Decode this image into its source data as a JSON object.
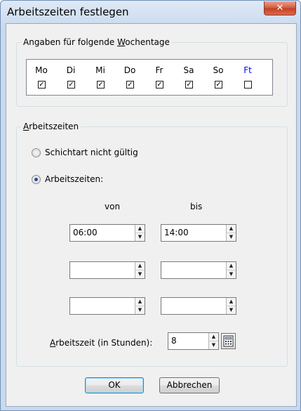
{
  "window": {
    "title": "Arbeitszeiten festlegen",
    "close_symbol": "✕"
  },
  "weekdays_group": {
    "label_before": "Angaben für folgende ",
    "label_underlined": "W",
    "label_after": "ochentage",
    "days": [
      {
        "label": "Mo",
        "checked": true,
        "color": "#000000"
      },
      {
        "label": "Di",
        "checked": true,
        "color": "#000000"
      },
      {
        "label": "Mi",
        "checked": true,
        "color": "#000000"
      },
      {
        "label": "Do",
        "checked": true,
        "color": "#000000"
      },
      {
        "label": "Fr",
        "checked": true,
        "color": "#000000"
      },
      {
        "label": "Sa",
        "checked": true,
        "color": "#000000"
      },
      {
        "label": "So",
        "checked": true,
        "color": "#000000"
      },
      {
        "label": "Ft",
        "checked": false,
        "color": "#0000ff"
      }
    ]
  },
  "worktime_group": {
    "label_underlined": "A",
    "label_after": "rbeitszeiten",
    "option_invalid": "Schichtart nicht gültig",
    "option_times": "Arbeitszeiten:",
    "selected_option": "Arbeitszeiten:",
    "col_from": "von",
    "col_to": "bis",
    "rows": [
      {
        "from": "06:00",
        "to": "14:00"
      },
      {
        "from": "",
        "to": ""
      },
      {
        "from": "",
        "to": ""
      }
    ],
    "hours_label_underlined": "A",
    "hours_label_after": "rbeitszeit (in Stunden):",
    "hours_value": "8"
  },
  "buttons": {
    "ok": "OK",
    "cancel": "Abbrechen"
  }
}
